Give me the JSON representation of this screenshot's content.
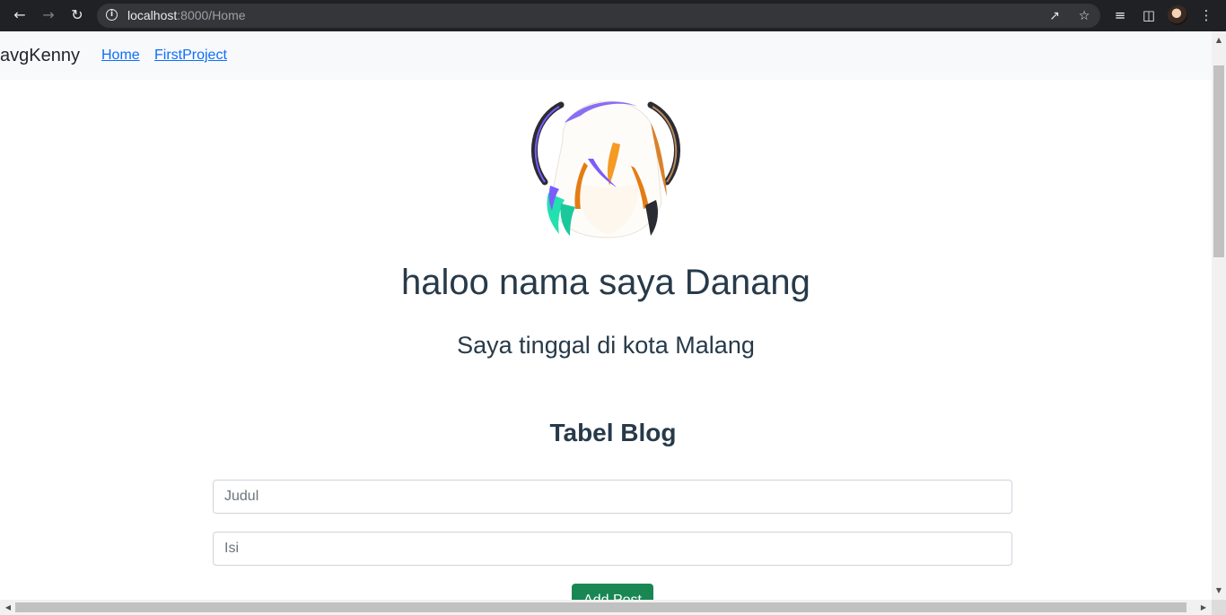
{
  "browser": {
    "url_host": "localhost",
    "url_rest": ":8000/Home",
    "icons": [
      "back-arrow-icon",
      "forward-arrow-icon",
      "reload-icon",
      "info-icon",
      "share-icon",
      "star-icon",
      "tab-search-icon",
      "side-panel-icon",
      "profile-avatar",
      "kebab-menu-icon"
    ]
  },
  "navbar": {
    "brand": "avgKenny",
    "links": [
      "Home",
      "FirstProject"
    ],
    "link_color": "#0d6efd"
  },
  "profile": {
    "heading": "haloo nama saya Danang",
    "subheading": "Saya tinggal di kota Malang",
    "image_icon": "anime-avatar-illustration"
  },
  "blog": {
    "title": "Tabel Blog",
    "title_placeholder": "Judul",
    "content_placeholder": "Isi",
    "submit_label": "Add Post",
    "button_color": "#198754"
  }
}
